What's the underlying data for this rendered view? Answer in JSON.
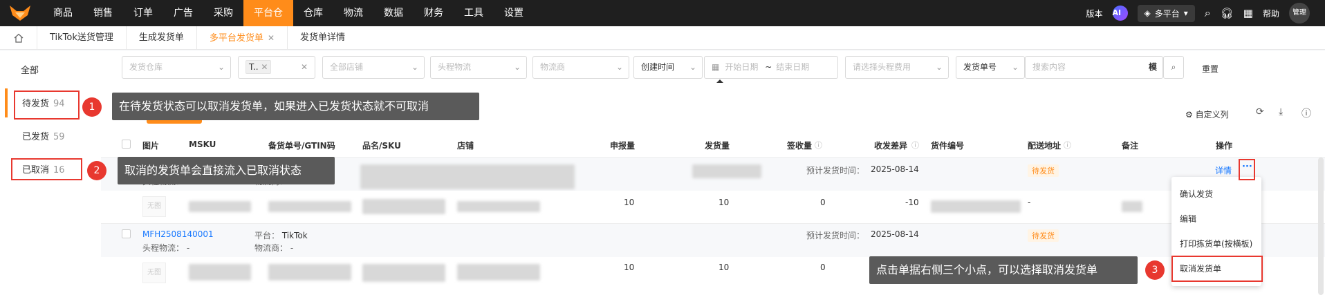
{
  "nav": {
    "items": [
      "商品",
      "销售",
      "订单",
      "广告",
      "采购",
      "平台仓",
      "仓库",
      "物流",
      "数据",
      "财务",
      "工具",
      "设置"
    ],
    "active_index": 5,
    "version": "版本",
    "ai": "AI",
    "platform": "多平台",
    "help": "帮助",
    "user": "管理"
  },
  "tabs": {
    "items": [
      "TikTok送货管理",
      "生成发货单",
      "多平台发货单",
      "发货单详情"
    ],
    "active_index": 2
  },
  "left": {
    "all": "全部",
    "pending": "待发货",
    "pending_count": "94",
    "shipped": "已发货",
    "shipped_count": "59",
    "cancelled": "已取消",
    "cancelled_count": "16"
  },
  "filters": {
    "warehouse": "发货仓库",
    "tag_value": "T..",
    "shop": "全部店铺",
    "first_logistics": "头程物流",
    "carrier": "物流商",
    "time_type": "创建时间",
    "start_date": "开始日期",
    "tilde": "~",
    "end_date": "结束日期",
    "fee": "请选择头程费用",
    "order_type": "发货单号",
    "search_placeholder": "搜索内容",
    "mode": "模",
    "reset": "重置"
  },
  "toolbar": {
    "customize": "自定义列"
  },
  "table": {
    "headers": [
      "图片",
      "MSKU",
      "备货单号/GTIN码",
      "品名/SKU",
      "店铺",
      "申报量",
      "发货量",
      "签收量",
      "收发差异",
      "货件编号",
      "配送地址",
      "备注",
      "操作"
    ],
    "orders": [
      {
        "logistics_label": "头程物流：",
        "logistics_value": "-",
        "carrier_label": "物流商：",
        "carrier_value": "-",
        "expected_label": "预计发货时间：",
        "expected_date": "2025-08-14",
        "status": "待发货",
        "detail": "详情",
        "more": "···",
        "item": {
          "no_image": "无图",
          "declared": "10",
          "shipped": "10",
          "signed": "0",
          "diff": "-10",
          "address": "-"
        }
      },
      {
        "order_no": "MFH2508140001",
        "platform_label": "平台：",
        "platform_value": "TikTok",
        "logistics_label": "头程物流：",
        "logistics_value": "-",
        "carrier_label": "物流商：",
        "carrier_value": "-",
        "expected_label": "预计发货时间：",
        "expected_date": "2025-08-14",
        "status": "待发货",
        "item": {
          "no_image": "无图",
          "declared": "10",
          "shipped": "10",
          "signed": "0"
        }
      }
    ]
  },
  "menu": {
    "items": [
      "确认发货",
      "编辑",
      "打印拣货单(按横板)",
      "取消发货单"
    ]
  },
  "callouts": [
    {
      "num": "1",
      "text": "在待发货状态可以取消发货单，如果进入已发货状态就不可取消"
    },
    {
      "num": "2",
      "text": "取消的发货单会直接流入已取消状态"
    },
    {
      "num": "3",
      "text": "点击单据右侧三个小点，可以选择取消发货单"
    }
  ],
  "colors": {
    "accent": "#ff8c1a",
    "highlight": "#e8382f",
    "link": "#1677ff",
    "topbar": "#1f1f1f"
  }
}
